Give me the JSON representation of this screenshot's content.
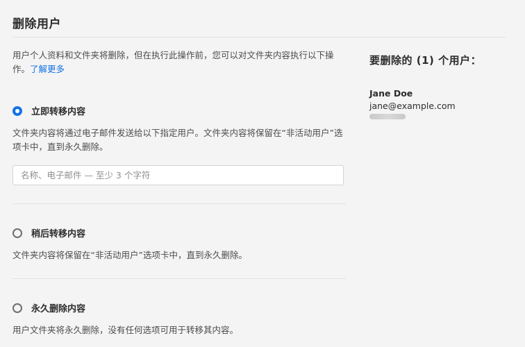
{
  "page": {
    "title": "删除用户"
  },
  "intro": {
    "text": "用户个人资料和文件夹将删除，但在执行此操作前，您可以对文件夹内容执行以下操作。",
    "learn_more": "了解更多"
  },
  "options": [
    {
      "label": "立即转移内容",
      "description": "文件夹内容将通过电子邮件发送给以下指定用户。文件夹内容将保留在“非活动用户”选项卡中，直到永久删除。",
      "selected": true
    },
    {
      "label": "稍后转移内容",
      "description": "文件夹内容将保留在“非活动用户”选项卡中，直到永久删除。",
      "selected": false
    },
    {
      "label": "永久删除内容",
      "description": "用户文件夹将永久删除，没有任何选项可用于转移其内容。",
      "selected": false
    }
  ],
  "search": {
    "value": "",
    "placeholder": "名称、电子邮件 — 至少 3 个字符"
  },
  "summary": {
    "title": "要删除的 (1) 个用户：",
    "users": [
      {
        "name": "Jane Doe",
        "email": "jane@example.com"
      }
    ]
  },
  "colors": {
    "accent": "#1473e6",
    "background": "#f4f4f4",
    "text": "#2c2c2c"
  }
}
